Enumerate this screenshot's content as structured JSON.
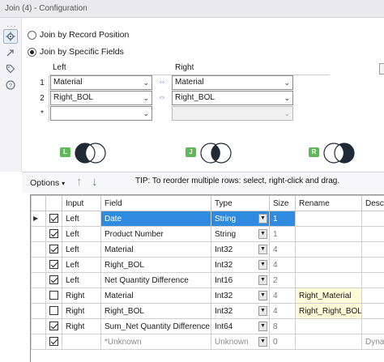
{
  "window": {
    "title": "Join (4) - Configuration"
  },
  "join_modes": [
    {
      "label": "Join by Record Position",
      "selected": false
    },
    {
      "label": "Join by Specific Fields",
      "selected": true
    }
  ],
  "join_fields": {
    "headers": {
      "left": "Left",
      "right": "Right"
    },
    "rows": [
      {
        "num": "1",
        "left": "Material",
        "right": "Material"
      },
      {
        "num": "2",
        "left": "Right_BOL",
        "right": "Right_BOL"
      },
      {
        "num": "*",
        "left": "",
        "right": ""
      }
    ]
  },
  "outputs": [
    {
      "badge": "L",
      "name": "left-output"
    },
    {
      "badge": "J",
      "name": "join-output"
    },
    {
      "badge": "R",
      "name": "right-output"
    }
  ],
  "options_bar": {
    "options_label": "Options",
    "tip": "TIP: To reorder multiple rows: select, right-click and drag."
  },
  "fields_table": {
    "columns": [
      "Input",
      "Field",
      "Type",
      "Size",
      "Rename",
      "Desc"
    ],
    "rows": [
      {
        "checked": true,
        "input": "Left",
        "field": "Date",
        "type": "String",
        "size": "1",
        "rename": "",
        "desc": "",
        "selected": true
      },
      {
        "checked": true,
        "input": "Left",
        "field": "Product Number",
        "type": "String",
        "size": "1",
        "rename": "",
        "desc": ""
      },
      {
        "checked": true,
        "input": "Left",
        "field": "Material",
        "type": "Int32",
        "size": "4",
        "rename": "",
        "desc": ""
      },
      {
        "checked": true,
        "input": "Left",
        "field": "Right_BOL",
        "type": "Int32",
        "size": "4",
        "rename": "",
        "desc": ""
      },
      {
        "checked": true,
        "input": "Left",
        "field": "Net Quantity Difference",
        "type": "Int16",
        "size": "2",
        "rename": "",
        "desc": ""
      },
      {
        "checked": false,
        "input": "Right",
        "field": "Material",
        "type": "Int32",
        "size": "4",
        "rename": "Right_Material",
        "desc": ""
      },
      {
        "checked": false,
        "input": "Right",
        "field": "Right_BOL",
        "type": "Int32",
        "size": "4",
        "rename": "Right_Right_BOL",
        "desc": ""
      },
      {
        "checked": true,
        "input": "Right",
        "field": "Sum_Net Quantity Difference",
        "type": "Int64",
        "size": "8",
        "rename": "",
        "desc": ""
      },
      {
        "checked": true,
        "input": "",
        "field": "*Unknown",
        "type": "Unknown",
        "size": "0",
        "rename": "",
        "desc": "Dynar",
        "gray": true
      }
    ]
  },
  "colors": {
    "selection": "#2f8be0",
    "venn_fill": "#1f2a36",
    "badge_green": "#5fb85a"
  }
}
